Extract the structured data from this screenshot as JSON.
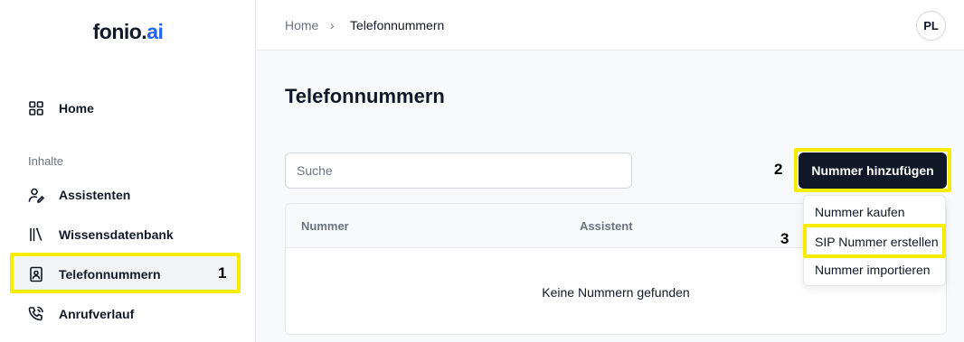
{
  "app": {
    "logo_main": "fonio.",
    "logo_accent": "ai"
  },
  "sidebar": {
    "section_label": "Inhalte",
    "items": [
      {
        "label": "Home",
        "icon": "grid-icon"
      },
      {
        "label": "Assistenten",
        "icon": "user-edit-icon"
      },
      {
        "label": "Wissensdatenbank",
        "icon": "library-icon"
      },
      {
        "label": "Telefonnummern",
        "icon": "contact-book-icon",
        "active": true
      },
      {
        "label": "Anrufverlauf",
        "icon": "phone-call-icon"
      }
    ]
  },
  "breadcrumb": {
    "home": "Home",
    "separator": "›",
    "current": "Telefonnummern"
  },
  "user": {
    "initials": "PL"
  },
  "main": {
    "title": "Telefonnummern",
    "search_placeholder": "Suche",
    "add_button": "Nummer hinzufügen",
    "table": {
      "columns": [
        "Nummer",
        "Assistent"
      ],
      "empty_text": "Keine Nummern gefunden"
    },
    "dropdown": {
      "items": [
        "Nummer kaufen",
        "SIP Nummer erstellen",
        "Nummer importieren"
      ]
    }
  },
  "annotations": {
    "labels": [
      "1",
      "2",
      "3"
    ],
    "highlight_color": "#f5ec00"
  }
}
